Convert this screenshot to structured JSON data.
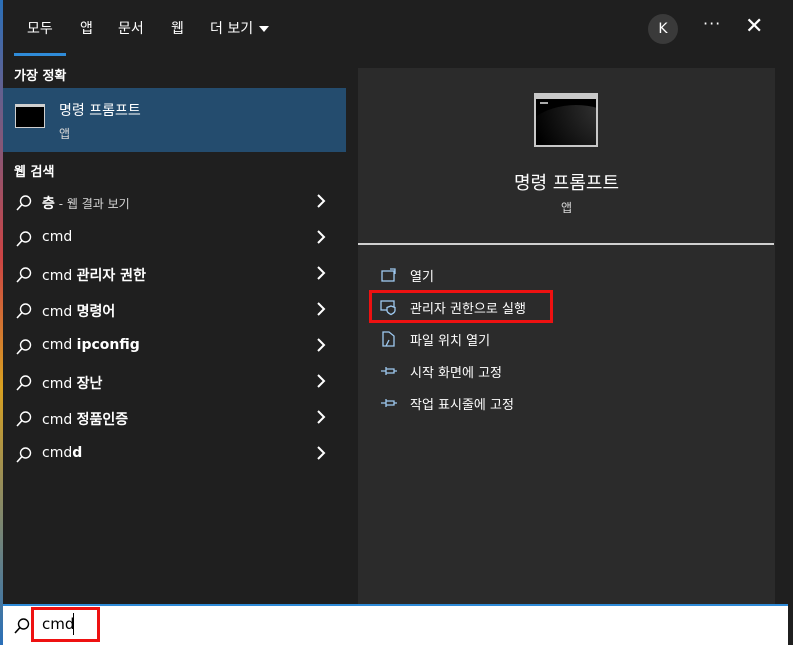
{
  "tabs": [
    {
      "label": "모두",
      "active": true
    },
    {
      "label": "앱"
    },
    {
      "label": "문서"
    },
    {
      "label": "웹"
    },
    {
      "label": "더 보기"
    }
  ],
  "header": {
    "avatar": "K",
    "more": "···",
    "close": "✕"
  },
  "best_match": {
    "heading": "가장 정확",
    "title": "명령 프롬프트",
    "subtitle": "앱"
  },
  "web_search": {
    "heading": "웹 검색",
    "items": [
      {
        "prefix": "",
        "bold": "층",
        "suffix": " - 웹 결과 보기"
      },
      {
        "prefix": "cmd",
        "bold": "",
        "suffix": ""
      },
      {
        "prefix": "cmd ",
        "bold": "관리자 권한",
        "suffix": ""
      },
      {
        "prefix": "cmd ",
        "bold": "명령어",
        "suffix": ""
      },
      {
        "prefix": "cmd ",
        "bold": "ipconfig",
        "suffix": ""
      },
      {
        "prefix": "cmd ",
        "bold": "장난",
        "suffix": ""
      },
      {
        "prefix": "cmd ",
        "bold": "정품인증",
        "suffix": ""
      },
      {
        "prefix": "cmd",
        "bold": "d",
        "suffix": ""
      }
    ]
  },
  "preview": {
    "title": "명령 프롬프트",
    "subtitle": "앱",
    "actions": [
      {
        "label": "열기",
        "icon": "open-icon"
      },
      {
        "label": "관리자 권한으로 실행",
        "icon": "shield-icon"
      },
      {
        "label": "파일 위치 열기",
        "icon": "file-location-icon"
      },
      {
        "label": "시작 화면에 고정",
        "icon": "pin-icon"
      },
      {
        "label": "작업 표시줄에 고정",
        "icon": "pin-icon"
      }
    ]
  },
  "search": {
    "value": "cmd"
  },
  "colors": {
    "accent": "#2f8bd8",
    "selected": "#244c6e",
    "highlight": "#e11111"
  }
}
